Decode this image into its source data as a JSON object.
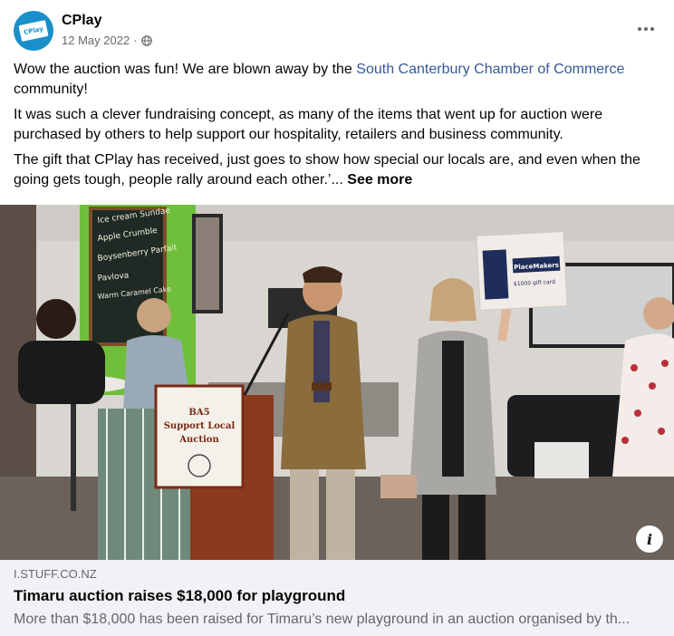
{
  "post": {
    "page_name": "CPlay",
    "avatar_text": "CPlay",
    "date": "12 May 2022",
    "separator": "·",
    "audience_icon": "globe-icon",
    "more_icon": "more-options-icon",
    "paragraph1_before": "Wow the auction was fun! We are blown away by the ",
    "paragraph1_link": "South Canterbury Chamber of Commerce",
    "paragraph1_after": " community!",
    "paragraph2": "It was such a clever fundraising concept, as many of the items that went up for auction were purchased by others to help support our hospitality, retailers and business community.",
    "paragraph3": "The gift that CPlay has received, just goes to show how special our locals are, and even when the going gets tough, people rally around each other.’...",
    "see_more": "See more"
  },
  "photo": {
    "chalkboard_lines": [
      "Ice cream Sundae",
      "Apple Crumble",
      "Boysenberry Parfait",
      "Pavlova",
      "Warm Caramel Cake"
    ],
    "podium_sign_lines": [
      "BA5",
      "Support Local",
      "Auction"
    ],
    "bid_card_brand": "PlaceMakers",
    "bid_card_sub": "$1000 gift card",
    "info_icon": "info-icon"
  },
  "link_preview": {
    "domain": "I.STUFF.CO.NZ",
    "title": "Timaru auction raises $18,000 for playground",
    "description": "More than $18,000 has been raised for Timaru’s new playground in an auction organised by th..."
  },
  "colors": {
    "link": "#385898",
    "secondary_text": "#65676b",
    "preview_bg": "#f0f2f5",
    "avatar_bg": "#1b8fc9"
  }
}
